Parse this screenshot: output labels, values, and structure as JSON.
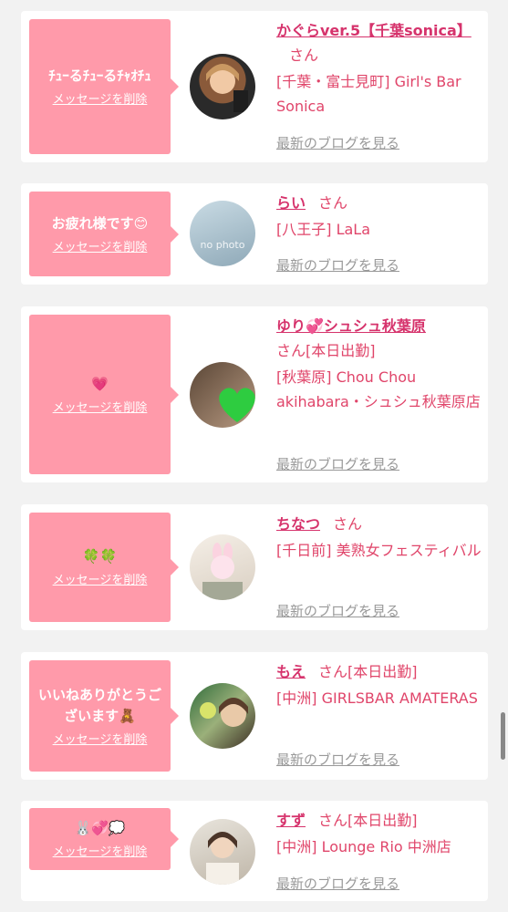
{
  "entries": [
    {
      "message": "ﾁｭｰるﾁｭｰるﾁｬｵﾁｭ",
      "delete_label": "メッセージを削除",
      "name": "かぐらver.5【千葉sonica】",
      "san": "さん",
      "shift": "",
      "shop": "[千葉・富士見町] Girl's Bar Sonica",
      "blog_label": "最新のブログを見る"
    },
    {
      "message": "お疲れ様です😊",
      "delete_label": "メッセージを削除",
      "name": "らい",
      "san": "さん",
      "shift": "",
      "shop": "[八王子] LaLa",
      "blog_label": "最新のブログを見る",
      "avatar_text": "no photo"
    },
    {
      "message": "💗",
      "delete_label": "メッセージを削除",
      "name": "ゆり💞シュシュ秋葉原",
      "san": "さん",
      "shift": "[本日出勤]",
      "shop": "[秋葉原] Chou Chou akihabara・シュシュ秋葉原店",
      "blog_label": "最新のブログを見る"
    },
    {
      "message": "🍀🍀",
      "delete_label": "メッセージを削除",
      "name": "ちなつ",
      "san": "さん",
      "shift": "",
      "shop": "[千日前] 美熟女フェスティバル",
      "blog_label": "最新のブログを見る"
    },
    {
      "message": "いいねありがとうございます🧸",
      "delete_label": "メッセージを削除",
      "name": "もえ",
      "san": "さん",
      "shift": "[本日出勤]",
      "shop": "[中洲] GIRLSBAR AMATERAS",
      "blog_label": "最新のブログを見る"
    },
    {
      "message": "🐰💞💭",
      "delete_label": "メッセージを削除",
      "name": "すず",
      "san": "さん",
      "shift": "[本日出勤]",
      "shop": "[中洲] Lounge Rio 中洲店",
      "blog_label": "最新のブログを見る"
    }
  ]
}
